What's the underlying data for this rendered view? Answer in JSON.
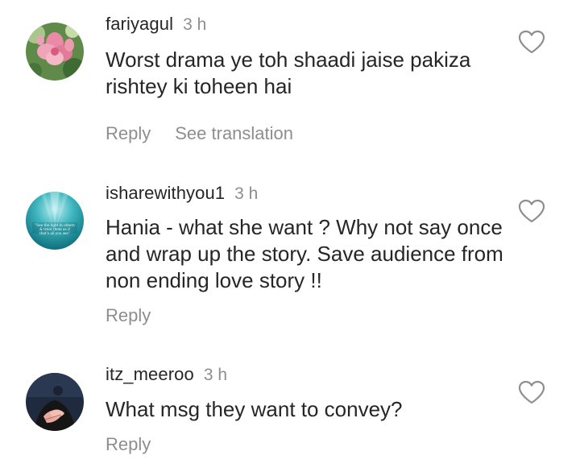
{
  "comments": [
    {
      "username": "fariyagul",
      "time": "3 h",
      "text": "Worst drama ye toh shaadi jaise pakiza rishtey ki toheen hai",
      "reply_label": "Reply",
      "translation_label": "See translation",
      "avatar_icon": "flower-avatar-icon"
    },
    {
      "username": "isharewithyou1",
      "time": "3 h",
      "text": "Hania - what she want ? Why not say once and wrap up the story. Save audience from non ending love story !!",
      "reply_label": "Reply",
      "avatar_icon": "ocean-quote-avatar-icon",
      "avatar_caption": "\"See the light in others & treat them as if that's all you see\""
    },
    {
      "username": "itz_meeroo",
      "time": "3 h",
      "text": "What msg they want to convey?",
      "reply_label": "Reply",
      "avatar_icon": "hands-avatar-icon"
    }
  ],
  "colors": {
    "text": "#262626",
    "secondary": "#8e8e8e",
    "background": "#ffffff"
  }
}
